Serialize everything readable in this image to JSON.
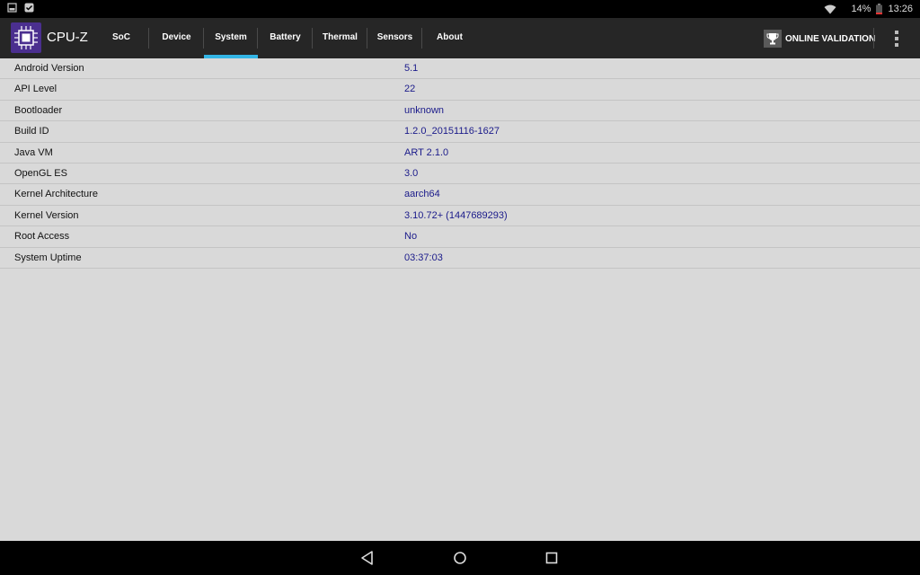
{
  "status_bar": {
    "left_icons": [
      "screenshot-icon",
      "check-notification-icon"
    ],
    "wifi_icon": "wifi-icon",
    "battery_percent": "14%",
    "battery_icon": "battery-icon",
    "time": "13:26"
  },
  "app_bar": {
    "logo_icon": "cpu-chip-icon",
    "title": "CPU-Z",
    "tabs": [
      {
        "label": "SoC",
        "active": false
      },
      {
        "label": "Device",
        "active": false
      },
      {
        "label": "System",
        "active": true
      },
      {
        "label": "Battery",
        "active": false
      },
      {
        "label": "Thermal",
        "active": false
      },
      {
        "label": "Sensors",
        "active": false
      },
      {
        "label": "About",
        "active": false
      }
    ],
    "validation_label": "ONLINE VALIDATION",
    "validation_icon": "trophy-icon",
    "overflow_icon": "more-vertical-icon"
  },
  "system": {
    "rows": [
      {
        "key": "Android Version",
        "value": "5.1"
      },
      {
        "key": "API Level",
        "value": "22"
      },
      {
        "key": "Bootloader",
        "value": "unknown"
      },
      {
        "key": "Build ID",
        "value": "1.2.0_20151116-1627"
      },
      {
        "key": "Java VM",
        "value": "ART 2.1.0"
      },
      {
        "key": "OpenGL ES",
        "value": "3.0"
      },
      {
        "key": "Kernel Architecture",
        "value": "aarch64"
      },
      {
        "key": "Kernel Version",
        "value": "3.10.72+ (1447689293)"
      },
      {
        "key": "Root Access",
        "value": "No"
      },
      {
        "key": "System Uptime",
        "value": "03:37:03"
      }
    ]
  },
  "nav_bar": {
    "icons": [
      "back-icon",
      "home-icon",
      "recents-icon"
    ]
  },
  "colors": {
    "accent": "#33b5e5",
    "app_bar_bg": "#262626",
    "content_bg": "#d9d9d9",
    "value_text": "#1a1a8a"
  }
}
